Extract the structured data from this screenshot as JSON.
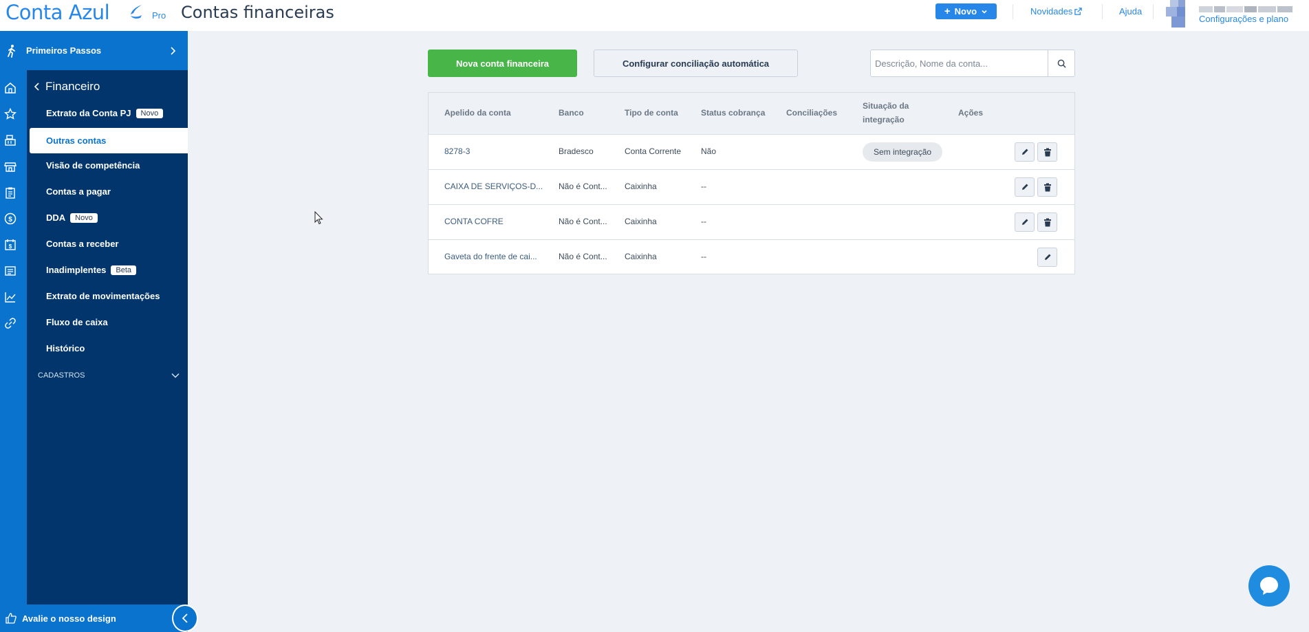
{
  "header": {
    "logo": "Conta Azul",
    "logo_suffix": "Pro",
    "page_title": "Contas financeiras",
    "new_button": "Novo",
    "novidades": "Novidades",
    "ajuda": "Ajuda",
    "config": "Configurações e plano"
  },
  "sidebar": {
    "primeiros_passos": "Primeiros Passos",
    "section_title": "Financeiro",
    "items": [
      {
        "label": "Extrato da Conta PJ",
        "badge": "Novo"
      },
      {
        "label": "Outras contas",
        "badge": ""
      },
      {
        "label": "Visão de competência",
        "badge": ""
      },
      {
        "label": "Contas a pagar",
        "badge": ""
      },
      {
        "label": "DDA",
        "badge": "Novo"
      },
      {
        "label": "Contas a receber",
        "badge": ""
      },
      {
        "label": "Inadimplentes",
        "badge": "Beta"
      },
      {
        "label": "Extrato de movimentações",
        "badge": ""
      },
      {
        "label": "Fluxo de caixa",
        "badge": ""
      },
      {
        "label": "Histórico",
        "badge": ""
      }
    ],
    "cadastros": "CADASTROS",
    "feedback": "Avalie o nosso design"
  },
  "toolbar": {
    "primary_button": "Nova conta financeira",
    "secondary_button": "Configurar conciliação automática",
    "search_placeholder": "Descrição, Nome da conta..."
  },
  "table": {
    "columns": [
      "Apelido da conta",
      "Banco",
      "Tipo de conta",
      "Status cobrança",
      "Conciliações",
      "Situação da integração",
      "Ações"
    ],
    "rows": [
      {
        "apelido": "8278-3",
        "banco": "Bradesco",
        "tipo": "Conta Corrente",
        "status": "Não",
        "conciliacoes": "",
        "integracao": "Sem integração",
        "can_delete": true
      },
      {
        "apelido": "CAIXA DE SERVIÇOS-D...",
        "banco": "Não é Cont...",
        "tipo": "Caixinha",
        "status": "--",
        "conciliacoes": "",
        "integracao": "",
        "can_delete": true
      },
      {
        "apelido": "CONTA COFRE",
        "banco": "Não é Cont...",
        "tipo": "Caixinha",
        "status": "--",
        "conciliacoes": "",
        "integracao": "",
        "can_delete": true
      },
      {
        "apelido": "Gaveta do frente de cai...",
        "banco": "Não é Cont...",
        "tipo": "Caixinha",
        "status": "--",
        "conciliacoes": "",
        "integracao": "",
        "can_delete": false
      }
    ]
  },
  "colors": {
    "brand": "#2687e9",
    "sidebar_dark": "#01356b",
    "sidebar_rail": "#0a73cd",
    "primary_green": "#48b549"
  },
  "icons": [
    "walking-person-icon",
    "home-icon",
    "star-icon",
    "cash-register-icon",
    "store-icon",
    "clipboard-icon",
    "dollar-icon",
    "calendar-money-icon",
    "receipt-icon",
    "chart-line-icon",
    "link-icon",
    "search-icon",
    "edit-icon",
    "trash-icon",
    "chat-icon",
    "thumbs-up-icon"
  ]
}
